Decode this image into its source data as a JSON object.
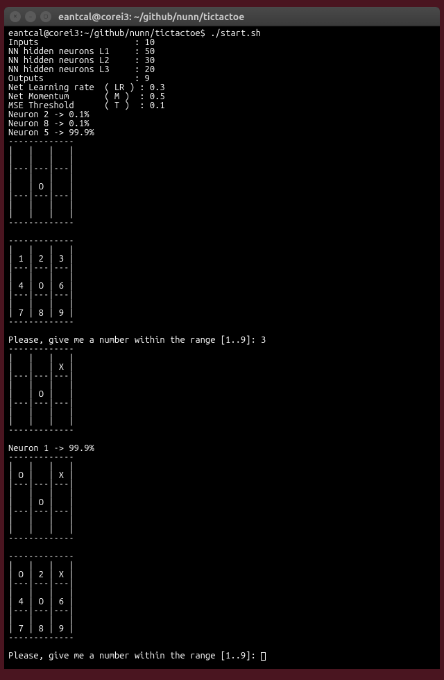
{
  "titlebar": {
    "title": "eantcal@corei3: ~/github/nunn/tictactoe"
  },
  "prompt": {
    "userhost": "eantcal@corei3",
    "path": "~/github/nunn/tictactoe",
    "command": "./start.sh"
  },
  "config_lines": [
    "Inputs                   : 10",
    "NN hidden neurons L1     : 50",
    "NN hidden neurons L2     : 30",
    "NN hidden neurons L3     : 20",
    "Outputs                  : 9",
    "Net Learning rate  ( LR ) : 0.3",
    "Net Momentum       ( M )  : 0.5",
    "MSE Threshold      ( T )  : 0.1"
  ],
  "neuron_lines_1": [
    "Neuron 2 -> 0.1%",
    "Neuron 8 -> 0.1%",
    "Neuron 5 -> 99.9%"
  ],
  "board_1": [
    "-------------",
    "|   |   |   |",
    "|   |   |   |",
    "|---|---|---|",
    "|   |   |   |",
    "|   | O |   |",
    "|---|---|---|",
    "|   |   |   |",
    "|   |   |   |",
    "-------------"
  ],
  "board_2": [
    "-------------",
    "|   |   |   |",
    "| 1 | 2 | 3 |",
    "|---|---|---|",
    "|   |   |   |",
    "| 4 | O | 6 |",
    "|---|---|---|",
    "|   |   |   |",
    "| 7 | 8 | 9 |",
    "-------------"
  ],
  "prompt_question_1": "Please, give me a number within the range [1..9]: 3",
  "board_3": [
    "-------------",
    "|   |   |   |",
    "|   |   | X |",
    "|---|---|---|",
    "|   |   |   |",
    "|   | O |   |",
    "|---|---|---|",
    "|   |   |   |",
    "|   |   |   |",
    "-------------"
  ],
  "neuron_lines_2": [
    "Neuron 1 -> 99.9%"
  ],
  "board_4": [
    "-------------",
    "|   |   |   |",
    "| O |   | X |",
    "|---|---|---|",
    "|   |   |   |",
    "|   | O |   |",
    "|---|---|---|",
    "|   |   |   |",
    "|   |   |   |",
    "-------------"
  ],
  "board_5": [
    "-------------",
    "|   |   |   |",
    "| O | 2 | X |",
    "|---|---|---|",
    "|   |   |   |",
    "| 4 | O | 6 |",
    "|---|---|---|",
    "|   |   |   |",
    "| 7 | 8 | 9 |",
    "-------------"
  ],
  "prompt_question_2": "Please, give me a number within the range [1..9]: "
}
